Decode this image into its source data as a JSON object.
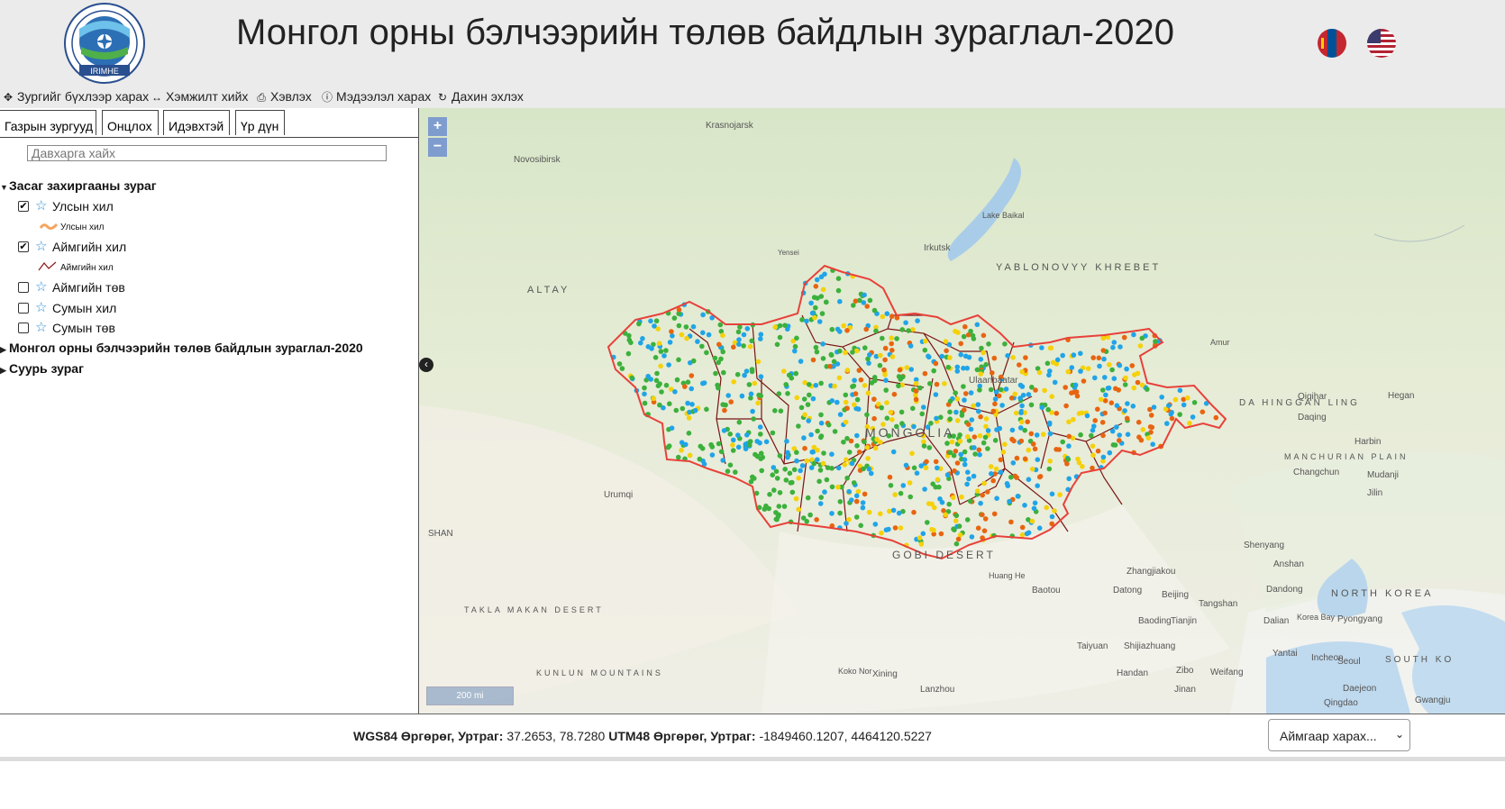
{
  "header": {
    "title": "Монгол орны бэлчээрийн төлөв байдлын зураглал-2020",
    "logo_text": "IRIMHE",
    "languages": [
      "mn-flag-icon",
      "us-flag-icon"
    ]
  },
  "toolbar": {
    "items": [
      {
        "icon": "expand-icon",
        "label": "Зургийг бүхлээр харах"
      },
      {
        "icon": "measure-icon",
        "label": "Хэмжилт хийх"
      },
      {
        "icon": "print-icon",
        "label": "Хэвлэх"
      },
      {
        "icon": "info-icon",
        "label": "Мэдээлэл харах"
      },
      {
        "icon": "refresh-icon",
        "label": "Дахин эхлэх"
      }
    ]
  },
  "sidebar": {
    "tabs": [
      "Газрын зургууд",
      "Онцлох",
      "Идэвхтэй",
      "Үр дүн"
    ],
    "search_placeholder": "Давхарга хайх",
    "groups": [
      {
        "label": "Засаг захиргааны зураг",
        "expanded": true,
        "layers": [
          {
            "label": "Улсын хил",
            "checked": true,
            "legend": "Улсын хил"
          },
          {
            "label": "Аймгийн хил",
            "checked": true,
            "legend": "Аймгийн хил"
          },
          {
            "label": "Аймгийн төв",
            "checked": false
          },
          {
            "label": "Сумын хил",
            "checked": false
          },
          {
            "label": "Сумын төв",
            "checked": false
          }
        ]
      },
      {
        "label": "Монгол орны бэлчээрийн төлөв байдлын зураглал-2020",
        "expanded": false
      },
      {
        "label": "Суурь зураг",
        "expanded": false
      }
    ]
  },
  "map": {
    "zoom_in": "+",
    "zoom_out": "−",
    "scale_label": "200 mi",
    "labels": [
      "Krasnojarsk",
      "Novosibirsk",
      "Irkutsk",
      "Lake Baikal",
      "YABLONOVYY KHREBET",
      "ALTAY",
      "Amur",
      "DA HINGGAN LING",
      "Qiqihar",
      "Daqing",
      "Harbin",
      "MANCHURIAN PLAIN",
      "Changchun",
      "Jilin",
      "Mudanji",
      "Hegan",
      "Ulaanbaatar",
      "MONGOLIA",
      "GOBI DESERT",
      "Urumqi",
      "SHAN",
      "TAKLA MAKAN DESERT",
      "KUNLUN MOUNTAINS",
      "Huang He",
      "Baotou",
      "Datong",
      "Zhangjiakou",
      "Beijing",
      "Tangshan",
      "Baoding",
      "Tianjin",
      "Shenyang",
      "Anshan",
      "Dandong",
      "NORTH KOREA",
      "Pyongyang",
      "Dalian",
      "Korea Bay",
      "Taiyuan",
      "Shijiazhuang",
      "Yantai",
      "Incheon",
      "Seoul",
      "SOUTH KO",
      "Handan",
      "Zibo",
      "Weifang",
      "Jinan",
      "Daejeon",
      "Qingdao",
      "Xining",
      "Lanzhou",
      "Koko Nor",
      "Yensei",
      "Gwangju"
    ],
    "point_colors": {
      "green": "#3cb03c",
      "blue": "#20a4e8",
      "yellow": "#f5d10a",
      "orange": "#e86410"
    },
    "border_color": "#e8413a",
    "province_border_color": "#7a1414"
  },
  "footer": {
    "wgs_label": "WGS84 Өргөрөг, Уртраг:",
    "wgs_value": "37.2653, 78.7280",
    "utm_label": "UTM48 Өргөрөг, Уртраг:",
    "utm_value": "-1849460.1207, 4464120.5227",
    "select_value": "Аймгаар харах..."
  }
}
